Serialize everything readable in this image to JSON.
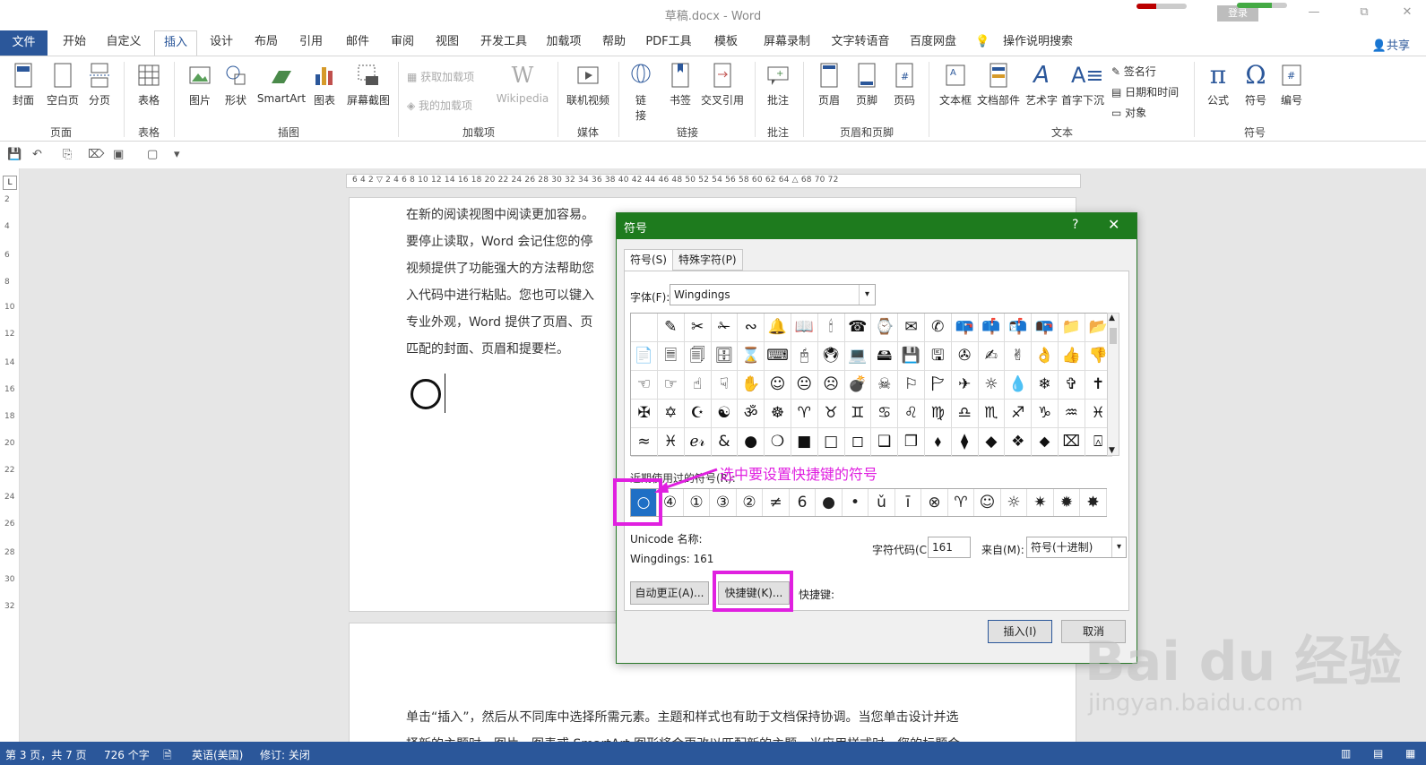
{
  "window": {
    "title": "草稿.docx  -  Word",
    "login": "登录",
    "minimize": "—",
    "restore": "⧉",
    "close": "✕"
  },
  "menu": {
    "file": "文件",
    "tabs": [
      "开始",
      "自定义",
      "插入",
      "设计",
      "布局",
      "引用",
      "邮件",
      "审阅",
      "视图",
      "开发工具",
      "加载项",
      "帮助",
      "PDF工具",
      "模板",
      "屏幕录制",
      "文字转语音",
      "百度网盘",
      "操作说明搜索"
    ],
    "active_tab": "插入",
    "share": "共享"
  },
  "ribbon": {
    "buttons": [
      "封面",
      "空白页",
      "分页",
      "表格",
      "图片",
      "形状",
      "SmartArt",
      "图表",
      "屏幕截图",
      "联机视频",
      "链接",
      "书签",
      "交叉引用",
      "批注",
      "页眉",
      "页脚",
      "页码",
      "文本框",
      "文档部件",
      "艺术字",
      "首字下沉",
      "公式",
      "符号",
      "编号"
    ],
    "link_btn": [
      "链",
      "接"
    ],
    "addins": [
      "获取加载项",
      "我的加载项"
    ],
    "wikipedia": "Wikipedia",
    "text_small": [
      "签名行",
      "日期和时间",
      "对象"
    ],
    "groups": [
      "页面",
      "表格",
      "插图",
      "加载项",
      "媒体",
      "链接",
      "批注",
      "页眉和页脚",
      "文本",
      "符号"
    ]
  },
  "ruler": {
    "h": "6  4  2  ▽  2  4  6  8  10  12  14  16  18  20  22  24  26  28  30  32  34  36  38  40  42  44  46  48  50  52  54  56  58  60  62  64  △  68  70  72",
    "v": [
      "2",
      "4",
      "6",
      "8",
      "10",
      "12",
      "14",
      "16",
      "18",
      "20",
      "22",
      "24",
      "26",
      "28",
      "30",
      "32"
    ],
    "corner": "L"
  },
  "document": {
    "lines": [
      "在新的阅读视图中阅读更加容易。",
      "要停止读取，Word 会记住您的停",
      "视频提供了功能强大的方法帮助您",
      "入代码中进行粘贴。您也可以键入",
      "专业外观，Word 提供了页眉、页",
      "匹配的封面、页眉和提要栏。"
    ],
    "inserted_symbol": "○",
    "page2_line1": "单击“插入”，然后从不同库中选择所需元素。主题和样式也有助于文档保持协调。当您单击设计并选",
    "page2_line2": "择新的主题时，图片、图表或 SmartArt 图形将会更改以匹配新的主题。当应用样式时，您的标题会"
  },
  "dialog": {
    "title": "符号",
    "help": "?",
    "close": "✕",
    "tabs": [
      "符号(S)",
      "特殊字符(P)"
    ],
    "font_label": "字体(F):",
    "font_value": "Wingdings",
    "symbols": [
      " ",
      "✎",
      "✂",
      "✁",
      "∾",
      "🔔",
      "📖",
      "🕯",
      "☎",
      "⌚",
      "✉",
      "✆",
      "📪",
      "📫",
      "📬",
      "📭",
      "📁",
      "📂",
      "📄",
      "🗏",
      "🗐",
      "🗄",
      "⌛",
      "⌨",
      "🖰",
      "🖲",
      "💻",
      "🖴",
      "💾",
      "🖫",
      "✇",
      "✍",
      "✌",
      "👌",
      "👍",
      "👎",
      "☜",
      "☞",
      "☝",
      "☟",
      "✋",
      "☺",
      "😐",
      "☹",
      "💣",
      "☠",
      "⚐",
      "🏱",
      "✈",
      "☼",
      "💧",
      "❄",
      "✞",
      "✝",
      "✠",
      "✡",
      "☪",
      "☯",
      "ॐ",
      "☸",
      "♈",
      "♉",
      "♊",
      "♋",
      "♌",
      "♍",
      "♎",
      "♏",
      "♐",
      "♑",
      "♒",
      "♓",
      "≈",
      "♓",
      "ℯ𝓇",
      "&",
      "●",
      "❍",
      "■",
      "□",
      "◻",
      "❑",
      "❒",
      "⬧",
      "⧫",
      "◆",
      "❖",
      "⬥",
      "⌧",
      "⍓"
    ],
    "recent_label": "近期使用过的符号(R):",
    "recent": [
      "○",
      "④",
      "①",
      "③",
      "②",
      "≠",
      "6",
      "●",
      "•",
      "ǔ",
      "ī",
      "⊗",
      "♈",
      "☺",
      "☼",
      "✷",
      "✹",
      "✸"
    ],
    "unicode_name_label": "Unicode 名称:",
    "unicode_name_value": "Wingdings: 161",
    "char_code_label": "字符代码(C):",
    "char_code_value": "161",
    "from_label": "来自(M):",
    "from_value": "符号(十进制)",
    "autocorrect_btn": "自动更正(A)...",
    "shortcut_btn": "快捷键(K)...",
    "shortcut_label": "快捷键:",
    "insert_btn": "插入(I)",
    "cancel_btn": "取消"
  },
  "annotation": {
    "text": "选中要设置快捷键的符号",
    "color": "#e020e0"
  },
  "status": {
    "page": "第 3 页，共 7 页",
    "words": "726 个字",
    "lang": "英语(美国)",
    "track": "修订: 关闭"
  },
  "watermark": {
    "main": "Bai du 经验",
    "sub": "jingyan.baidu.com"
  },
  "colors": {
    "ribbon_blue": "#2b579a",
    "dialog_green": "#1e7b1e",
    "selected_symbol": "#1f6fc5"
  }
}
